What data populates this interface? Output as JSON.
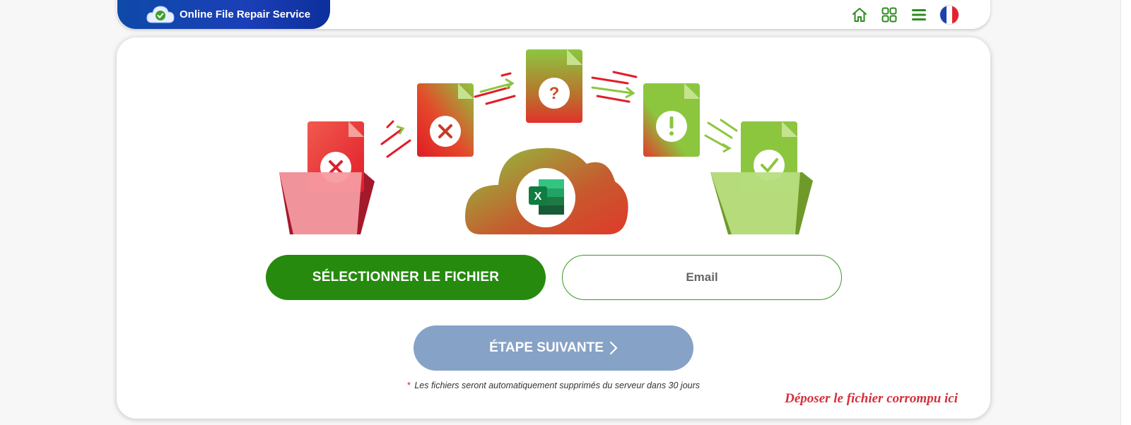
{
  "header": {
    "brand_title": "Online File Repair Service",
    "icons": [
      "home-icon",
      "grid-icon",
      "menu-icon",
      "french-flag-icon"
    ]
  },
  "colors": {
    "brand_blue": "#1b3fb8",
    "primary_green": "#268a0e",
    "next_button": "#86a2c6",
    "accent_red": "#d32f3a"
  },
  "illustration": {
    "stage_icons": [
      "x-mark-icon",
      "x-mark-icon",
      "question-mark-icon",
      "exclamation-mark-icon",
      "check-mark-icon"
    ],
    "center_icon": "excel-icon"
  },
  "form": {
    "select_label": "SÉLECTIONNER LE FICHIER",
    "email_placeholder": "Email",
    "next_label": "ÉTAPE SUIVANTE"
  },
  "footer": {
    "asterisk": "*",
    "note": "Les fichiers seront automatiquement supprimés du serveur dans 30 jours",
    "drop_text": "Déposer le fichier corrompu ici"
  }
}
